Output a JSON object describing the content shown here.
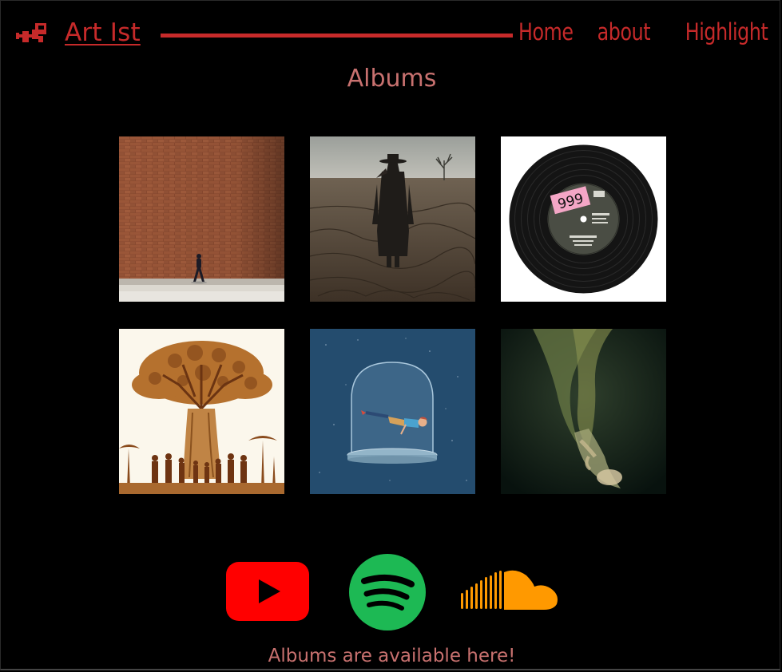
{
  "header": {
    "brand": "Art Ist",
    "nav": [
      {
        "label": "Home"
      },
      {
        "label": "about"
      },
      {
        "label": "Highlight"
      }
    ]
  },
  "main": {
    "title": "Albums",
    "albums": [
      {
        "cover": "brick-wall-walker"
      },
      {
        "cover": "plague-doctor-field"
      },
      {
        "cover": "vinyl-999-record",
        "label_text": "999"
      },
      {
        "cover": "baobab-tree-people"
      },
      {
        "cover": "glass-dome-floating-man"
      },
      {
        "cover": "underwater-woman"
      }
    ]
  },
  "socials": [
    {
      "name": "youtube",
      "icon": "youtube-icon",
      "color": "#ff0000"
    },
    {
      "name": "spotify",
      "icon": "spotify-icon",
      "color": "#1db954"
    },
    {
      "name": "soundcloud",
      "icon": "soundcloud-icon",
      "color": "#ff8800"
    }
  ],
  "footer": {
    "caption": "Albums are available here!"
  },
  "colors": {
    "accent": "#c62a2a",
    "title": "#c8716f",
    "background": "#000000"
  }
}
